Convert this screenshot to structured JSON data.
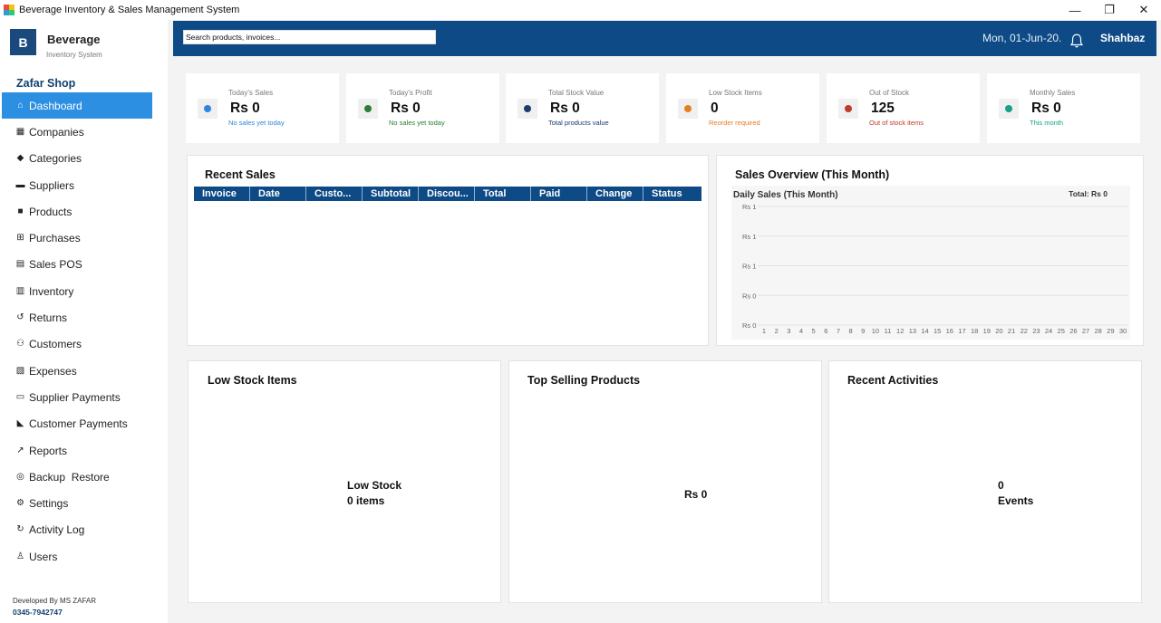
{
  "window": {
    "title": "Beverage Inventory & Sales Management System",
    "minimize": "—",
    "restore": "❐",
    "close": "✕"
  },
  "sidebar": {
    "logo_letter": "B",
    "brand_name": "Beverage",
    "brand_sub": "Inventory System",
    "shop_name": "Zafar Shop",
    "items": [
      {
        "label": "Dashboard",
        "icon": "home-icon",
        "glyph": "⌂",
        "active": true
      },
      {
        "label": "Companies",
        "icon": "building-icon",
        "glyph": "▦"
      },
      {
        "label": "Categories",
        "icon": "tag-icon",
        "glyph": "◆"
      },
      {
        "label": "Suppliers",
        "icon": "truck-icon",
        "glyph": "▬"
      },
      {
        "label": "Products",
        "icon": "box-icon",
        "glyph": "■"
      },
      {
        "label": "Purchases",
        "icon": "cart-icon",
        "glyph": "⊞"
      },
      {
        "label": "Sales POS",
        "icon": "cash-register-icon",
        "glyph": "▤"
      },
      {
        "label": "Inventory",
        "icon": "warehouse-icon",
        "glyph": "▥"
      },
      {
        "label": "Returns",
        "icon": "undo-icon",
        "glyph": "↺"
      },
      {
        "label": "Customers",
        "icon": "users-icon",
        "glyph": "⚇"
      },
      {
        "label": "Expenses",
        "icon": "receipt-icon",
        "glyph": "▧"
      },
      {
        "label": "Supplier Payments",
        "icon": "money-icon",
        "glyph": "▭"
      },
      {
        "label": "Customer Payments",
        "icon": "hand-money-icon",
        "glyph": "◣"
      },
      {
        "label": "Reports",
        "icon": "line-chart-icon",
        "glyph": "↗"
      },
      {
        "label": "Backup  Restore",
        "icon": "database-icon",
        "glyph": "◎"
      },
      {
        "label": "Settings",
        "icon": "gear-icon",
        "glyph": "⚙"
      },
      {
        "label": "Activity Log",
        "icon": "history-icon",
        "glyph": "↻"
      },
      {
        "label": "Users",
        "icon": "user-icon",
        "glyph": "♙"
      }
    ],
    "developer": "Developed By MS ZAFAR",
    "phone": "0345-7942747"
  },
  "header": {
    "search_placeholder": "Search products, invoices...",
    "date": "Mon, 01-Jun-20.",
    "user": "Shahbaz"
  },
  "stats": [
    {
      "label": "Today's Sales",
      "value": "Rs 0",
      "sub": "No sales yet today",
      "dot_color": "#2e86de",
      "sub_color": "#2e86de"
    },
    {
      "label": "Today's Profit",
      "value": "Rs 0",
      "sub": "No sales yet today",
      "dot_color": "#2e7d32",
      "sub_color": "#2e7d32"
    },
    {
      "label": "Total Stock Value",
      "value": "Rs 0",
      "sub": "Total products value",
      "dot_color": "#1a3d6b",
      "sub_color": "#1a3d6b"
    },
    {
      "label": "Low Stock Items",
      "value": "0",
      "sub": "Reorder required",
      "dot_color": "#e67e22",
      "sub_color": "#e67e22"
    },
    {
      "label": "Out of Stock",
      "value": "125",
      "sub": "Out of stock items",
      "dot_color": "#c0392b",
      "sub_color": "#c0392b"
    },
    {
      "label": "Monthly Sales",
      "value": "Rs 0",
      "sub": "This month",
      "dot_color": "#16a085",
      "sub_color": "#16a085"
    }
  ],
  "recent_sales": {
    "title": "Recent Sales",
    "columns": [
      "Invoice",
      "Date",
      "Custo...",
      "Subtotal",
      "Discou...",
      "Total",
      "Paid",
      "Change",
      "Status"
    ]
  },
  "sales_overview": {
    "title": "Sales Overview (This Month)"
  },
  "chart_data": {
    "type": "line",
    "title": "Daily Sales (This Month)",
    "total_label": "Total: Rs 0",
    "x": [
      1,
      2,
      3,
      4,
      5,
      6,
      7,
      8,
      9,
      10,
      11,
      12,
      13,
      14,
      15,
      16,
      17,
      18,
      19,
      20,
      21,
      22,
      23,
      24,
      25,
      26,
      27,
      28,
      29,
      30
    ],
    "y_tick_labels": [
      "Rs 1",
      "Rs 1",
      "Rs 1",
      "Rs 0",
      "Rs 0"
    ],
    "series": [],
    "grid": true
  },
  "low_stock": {
    "title": "Low Stock Items",
    "line1": "Low Stock",
    "line2": "0 items"
  },
  "top_selling": {
    "title": "Top Selling Products",
    "value": "Rs 0"
  },
  "recent_activities": {
    "title": "Recent Activities",
    "count": "0",
    "label": "Events"
  }
}
